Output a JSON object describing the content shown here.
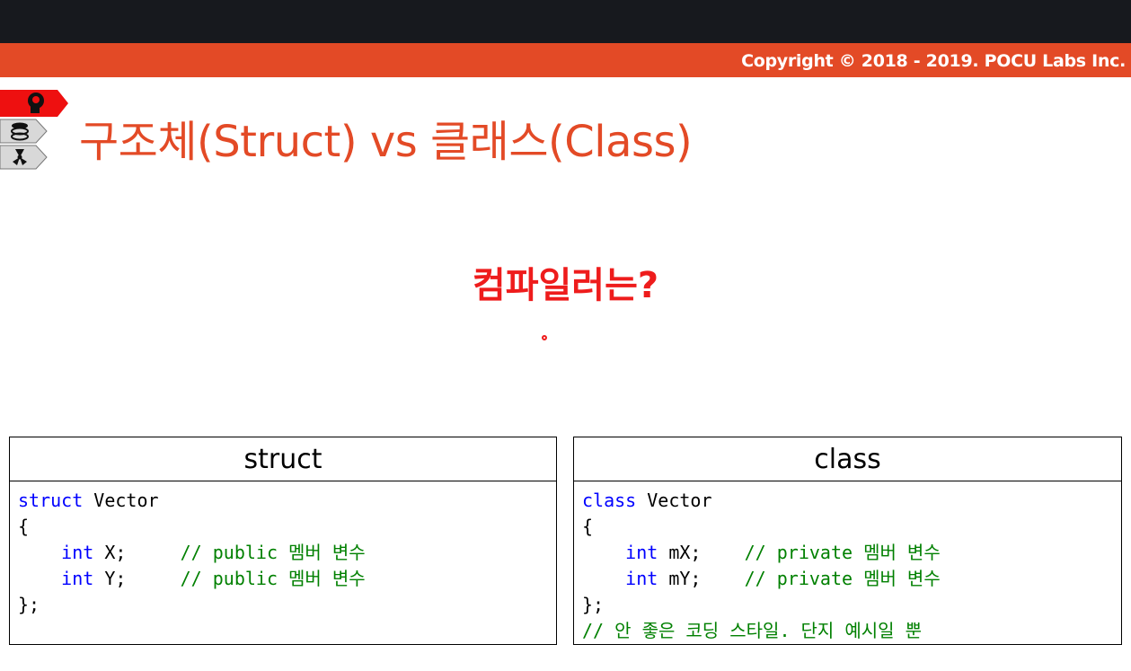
{
  "header": {
    "copyright": "Copyright © 2018 - 2019. POCU Labs Inc."
  },
  "slide": {
    "title": "구조체(Struct) vs 클래스(Class)",
    "question": "컴파일러는?"
  },
  "nav_icons": [
    "brain-head-icon",
    "layers-icon",
    "radiation-icon"
  ],
  "colors": {
    "accent": "#e34a26",
    "question": "#ee1c1c",
    "keyword": "#0000ff",
    "comment": "#008000"
  },
  "panels": {
    "struct": {
      "header": "struct",
      "line1_kw": "struct",
      "line1_name": " Vector",
      "open": "{",
      "m1_kw": "int",
      "m1_name": " X;     ",
      "m1_comment": "// public 멤버 변수",
      "m2_kw": "int",
      "m2_name": " Y;     ",
      "m2_comment": "// public 멤버 변수",
      "close": "};"
    },
    "class": {
      "header": "class",
      "line1_kw": "class",
      "line1_name": " Vector",
      "open": "{",
      "m1_kw": "int",
      "m1_name": " mX;    ",
      "m1_comment": "// private 멤버 변수",
      "m2_kw": "int",
      "m2_name": " mY;    ",
      "m2_comment": "// private 멤버 변수",
      "close": "};",
      "note": "// 안 좋은 코딩 스타일. 단지 예시일 뿐"
    }
  }
}
